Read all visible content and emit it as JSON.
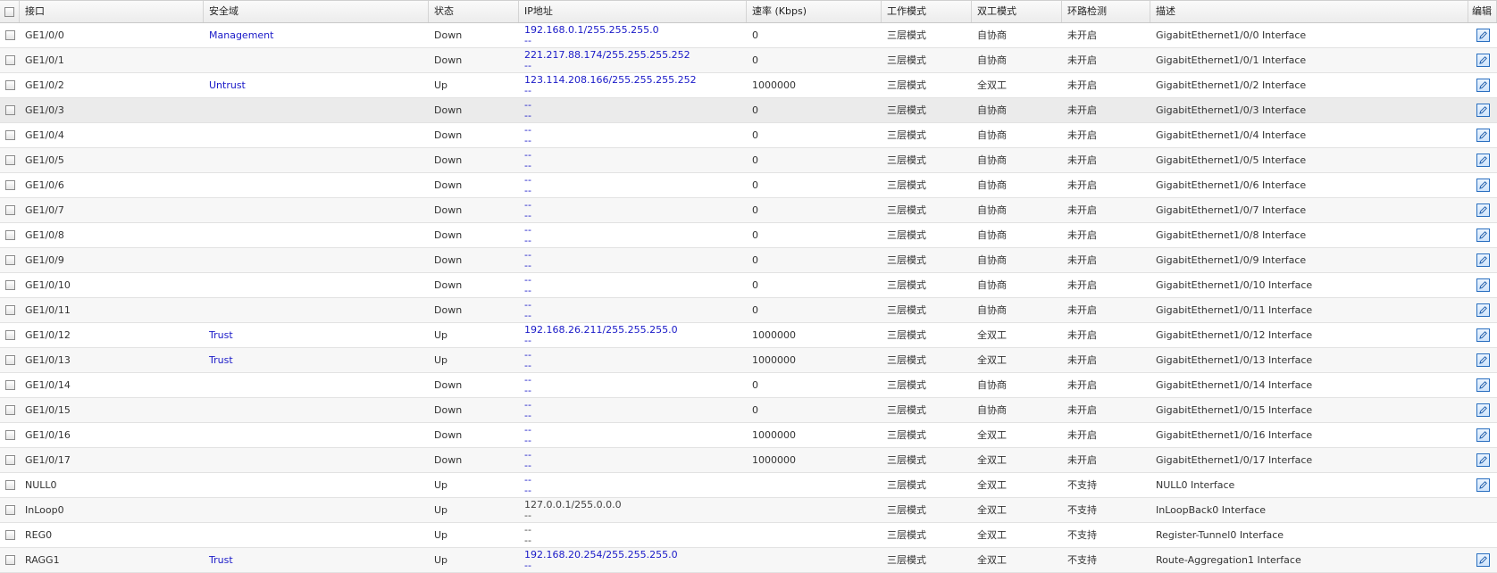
{
  "columns": {
    "interface": "接口",
    "zone": "安全域",
    "status": "状态",
    "ip": "IP地址",
    "speed": "速率 (Kbps)",
    "mode": "工作模式",
    "duplex": "双工模式",
    "loop": "环路检测",
    "desc": "描述",
    "edit": "编辑"
  },
  "rows": [
    {
      "name": "GE1/0/0",
      "zone": "Management",
      "status": "Down",
      "ip1": "192.168.0.1/255.255.255.0",
      "ip2": "--",
      "speed": "0",
      "mode": "三层模式",
      "duplex": "自协商",
      "loop": "未开启",
      "desc": "GigabitEthernet1/0/0 Interface",
      "editable": true
    },
    {
      "name": "GE1/0/1",
      "zone": "",
      "status": "Down",
      "ip1": "221.217.88.174/255.255.255.252",
      "ip2": "--",
      "speed": "0",
      "mode": "三层模式",
      "duplex": "自协商",
      "loop": "未开启",
      "desc": "GigabitEthernet1/0/1 Interface",
      "editable": true
    },
    {
      "name": "GE1/0/2",
      "zone": "Untrust",
      "status": "Up",
      "ip1": "123.114.208.166/255.255.255.252",
      "ip2": "--",
      "speed": "1000000",
      "mode": "三层模式",
      "duplex": "全双工",
      "loop": "未开启",
      "desc": "GigabitEthernet1/0/2 Interface",
      "editable": true
    },
    {
      "name": "GE1/0/3",
      "zone": "",
      "status": "Down",
      "ip1": "--",
      "ip2": "--",
      "speed": "0",
      "mode": "三层模式",
      "duplex": "自协商",
      "loop": "未开启",
      "desc": "GigabitEthernet1/0/3 Interface",
      "editable": true
    },
    {
      "name": "GE1/0/4",
      "zone": "",
      "status": "Down",
      "ip1": "--",
      "ip2": "--",
      "speed": "0",
      "mode": "三层模式",
      "duplex": "自协商",
      "loop": "未开启",
      "desc": "GigabitEthernet1/0/4 Interface",
      "editable": true
    },
    {
      "name": "GE1/0/5",
      "zone": "",
      "status": "Down",
      "ip1": "--",
      "ip2": "--",
      "speed": "0",
      "mode": "三层模式",
      "duplex": "自协商",
      "loop": "未开启",
      "desc": "GigabitEthernet1/0/5 Interface",
      "editable": true
    },
    {
      "name": "GE1/0/6",
      "zone": "",
      "status": "Down",
      "ip1": "--",
      "ip2": "--",
      "speed": "0",
      "mode": "三层模式",
      "duplex": "自协商",
      "loop": "未开启",
      "desc": "GigabitEthernet1/0/6 Interface",
      "editable": true
    },
    {
      "name": "GE1/0/7",
      "zone": "",
      "status": "Down",
      "ip1": "--",
      "ip2": "--",
      "speed": "0",
      "mode": "三层模式",
      "duplex": "自协商",
      "loop": "未开启",
      "desc": "GigabitEthernet1/0/7 Interface",
      "editable": true
    },
    {
      "name": "GE1/0/8",
      "zone": "",
      "status": "Down",
      "ip1": "--",
      "ip2": "--",
      "speed": "0",
      "mode": "三层模式",
      "duplex": "自协商",
      "loop": "未开启",
      "desc": "GigabitEthernet1/0/8 Interface",
      "editable": true
    },
    {
      "name": "GE1/0/9",
      "zone": "",
      "status": "Down",
      "ip1": "--",
      "ip2": "--",
      "speed": "0",
      "mode": "三层模式",
      "duplex": "自协商",
      "loop": "未开启",
      "desc": "GigabitEthernet1/0/9 Interface",
      "editable": true
    },
    {
      "name": "GE1/0/10",
      "zone": "",
      "status": "Down",
      "ip1": "--",
      "ip2": "--",
      "speed": "0",
      "mode": "三层模式",
      "duplex": "自协商",
      "loop": "未开启",
      "desc": "GigabitEthernet1/0/10 Interface",
      "editable": true
    },
    {
      "name": "GE1/0/11",
      "zone": "",
      "status": "Down",
      "ip1": "--",
      "ip2": "--",
      "speed": "0",
      "mode": "三层模式",
      "duplex": "自协商",
      "loop": "未开启",
      "desc": "GigabitEthernet1/0/11 Interface",
      "editable": true
    },
    {
      "name": "GE1/0/12",
      "zone": "Trust",
      "status": "Up",
      "ip1": "192.168.26.211/255.255.255.0",
      "ip2": "--",
      "speed": "1000000",
      "mode": "三层模式",
      "duplex": "全双工",
      "loop": "未开启",
      "desc": "GigabitEthernet1/0/12 Interface",
      "editable": true
    },
    {
      "name": "GE1/0/13",
      "zone": "Trust",
      "status": "Up",
      "ip1": "--",
      "ip2": "--",
      "speed": "1000000",
      "mode": "三层模式",
      "duplex": "全双工",
      "loop": "未开启",
      "desc": "GigabitEthernet1/0/13 Interface",
      "editable": true
    },
    {
      "name": "GE1/0/14",
      "zone": "",
      "status": "Down",
      "ip1": "--",
      "ip2": "--",
      "speed": "0",
      "mode": "三层模式",
      "duplex": "自协商",
      "loop": "未开启",
      "desc": "GigabitEthernet1/0/14 Interface",
      "editable": true
    },
    {
      "name": "GE1/0/15",
      "zone": "",
      "status": "Down",
      "ip1": "--",
      "ip2": "--",
      "speed": "0",
      "mode": "三层模式",
      "duplex": "自协商",
      "loop": "未开启",
      "desc": "GigabitEthernet1/0/15 Interface",
      "editable": true
    },
    {
      "name": "GE1/0/16",
      "zone": "",
      "status": "Down",
      "ip1": "--",
      "ip2": "--",
      "speed": "1000000",
      "mode": "三层模式",
      "duplex": "全双工",
      "loop": "未开启",
      "desc": "GigabitEthernet1/0/16 Interface",
      "editable": true
    },
    {
      "name": "GE1/0/17",
      "zone": "",
      "status": "Down",
      "ip1": "--",
      "ip2": "--",
      "speed": "1000000",
      "mode": "三层模式",
      "duplex": "全双工",
      "loop": "未开启",
      "desc": "GigabitEthernet1/0/17 Interface",
      "editable": true
    },
    {
      "name": "NULL0",
      "zone": "",
      "status": "Up",
      "ip1": "--",
      "ip2": "--",
      "speed": "",
      "mode": "三层模式",
      "duplex": "全双工",
      "loop": "不支持",
      "desc": "NULL0 Interface",
      "editable": true
    },
    {
      "name": "InLoop0",
      "zone": "",
      "status": "Up",
      "ip1": "127.0.0.1/255.0.0.0",
      "ip2": "--",
      "speed": "",
      "mode": "三层模式",
      "duplex": "全双工",
      "loop": "不支持",
      "desc": "InLoopBack0 Interface",
      "editable": false,
      "ip_plain": true
    },
    {
      "name": "REG0",
      "zone": "",
      "status": "Up",
      "ip1": "--",
      "ip2": "--",
      "speed": "",
      "mode": "三层模式",
      "duplex": "全双工",
      "loop": "不支持",
      "desc": "Register-Tunnel0 Interface",
      "editable": false,
      "ip_plain": true
    },
    {
      "name": "RAGG1",
      "zone": "Trust",
      "status": "Up",
      "ip1": "192.168.20.254/255.255.255.0",
      "ip2": "--",
      "speed": "",
      "mode": "三层模式",
      "duplex": "全双工",
      "loop": "不支持",
      "desc": "Route-Aggregation1 Interface",
      "editable": true
    }
  ]
}
